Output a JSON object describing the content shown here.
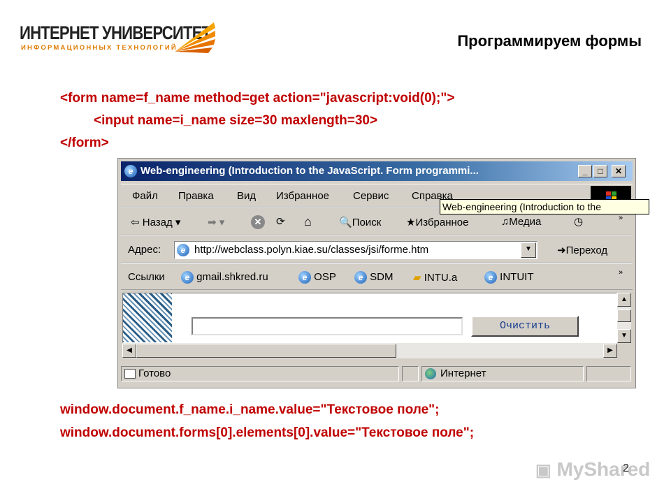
{
  "header": {
    "logo_main": "ИНТЕРНЕТ УНИВЕРСИТЕТ",
    "logo_sub": "ИНФОРМАЦИОННЫХ ТЕХНОЛОГИЙ",
    "title": "Программируем формы"
  },
  "code_top": [
    "<form name=f_name method=get action=\"javascript:void(0);\">",
    "<input name=i_name size=30 maxlength=30>",
    "</form>"
  ],
  "browser": {
    "title": "Web-engineering (Introduction to the JavaScript. Form programmi...",
    "menu": [
      "Файл",
      "Правка",
      "Вид",
      "Избранное",
      "Сервис",
      "Справка"
    ],
    "tooltip": "Web-engineering (Introduction to the",
    "toolbar": {
      "back": "Назад",
      "search": "Поиск",
      "favorites": "Избранное",
      "media": "Медиа"
    },
    "address_label": "Адрес:",
    "address_value": "http://webclass.polyn.kiae.su/classes/jsi/forme.htm",
    "go_label": "Переход",
    "links_label": "Ссылки",
    "links": [
      "gmail.shkred.ru",
      "OSP",
      "SDM",
      "INTU.a",
      "INTUIT"
    ],
    "form_input_value": "",
    "clear_button": "Очистить",
    "status_text": "Готово",
    "zone_text": "Интернет"
  },
  "code_bottom": [
    "window.document.f_name.i_name.value=\"Текстовое поле\";",
    "window.document.forms[0].elements[0].value=\"Текстовое поле\";"
  ],
  "footer": {
    "page_number": "2",
    "watermark": "MyShared"
  },
  "colors": {
    "code": "#c00000",
    "titlebar": "#0a246a",
    "chrome": "#d4d0c8",
    "logo_accent": "#e07b00"
  }
}
